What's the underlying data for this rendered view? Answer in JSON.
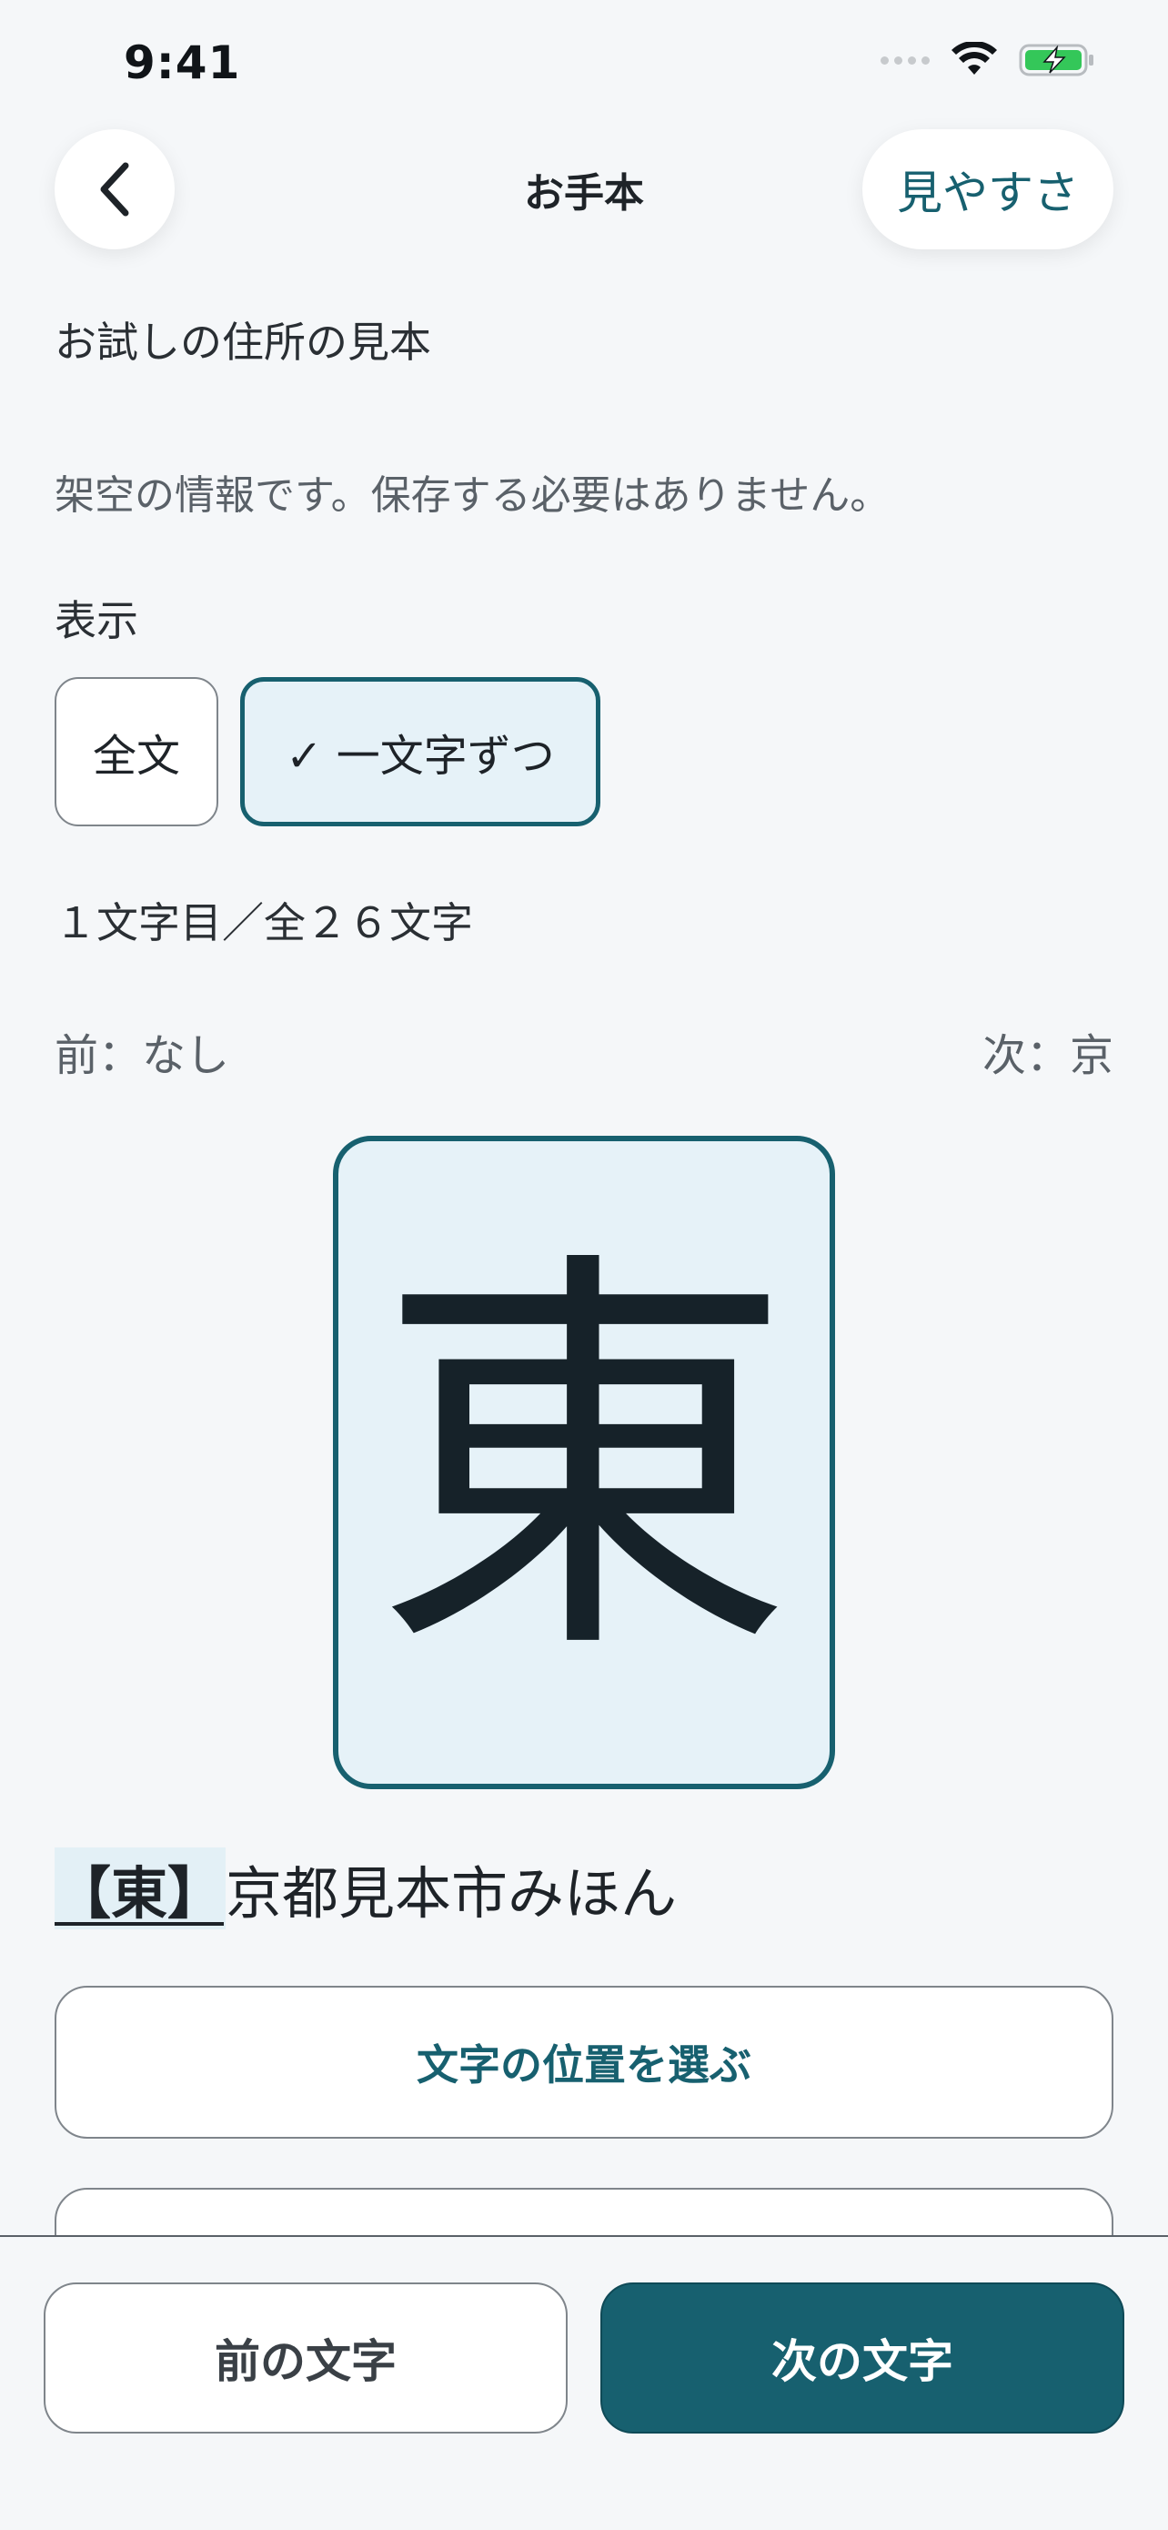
{
  "status_bar": {
    "time": "9:41"
  },
  "nav": {
    "title": "お手本",
    "view_button": "見やすさ"
  },
  "content": {
    "heading": "お試しの住所の見本",
    "note": "架空の情報です。保存する必要はありません。",
    "display_label": "表示",
    "modes": [
      {
        "label": "全文",
        "selected": false
      },
      {
        "label": "✓ 一文字ずつ",
        "selected": true
      }
    ],
    "progress": "１文字目／全２６文字",
    "prev_char": "前：なし",
    "next_char": "次：京",
    "current_char": "東",
    "address_highlight": "【東】",
    "address_rest": "京都見本市みほん",
    "select_position_button": "文字の位置を選ぶ"
  },
  "bottom": {
    "prev_button": "前の文字",
    "next_button": "次の文字"
  },
  "colors": {
    "accent": "#17606f",
    "card_bg": "#e6f2f8",
    "page_bg": "#f5f7f9"
  }
}
